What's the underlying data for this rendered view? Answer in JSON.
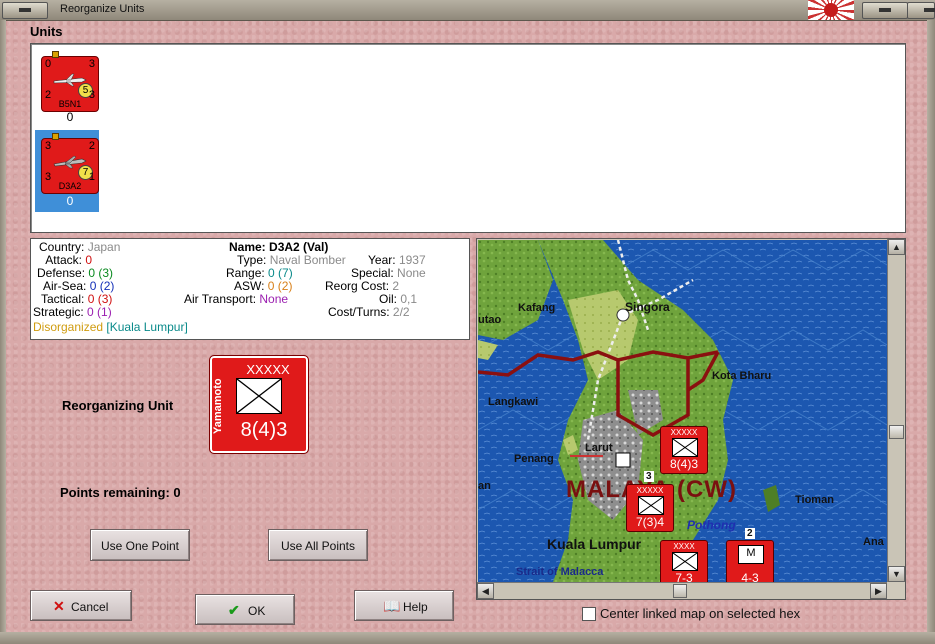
{
  "window": {
    "title": "Reorganize Units"
  },
  "units_section": {
    "label": "Units",
    "units": [
      {
        "name": "B5N1",
        "top_left": "0",
        "top_right": "3",
        "bottom_left": "2",
        "bottom_right": "3",
        "badge": "5",
        "count": "0"
      },
      {
        "name": "D3A2",
        "top_left": "3",
        "top_right": "2",
        "bottom_left": "3",
        "bottom_right": "1",
        "badge": "7",
        "count": "0",
        "selected": true
      }
    ]
  },
  "details": {
    "country_label": "Country:",
    "country": "Japan",
    "attack_label": "Attack:",
    "attack": "0",
    "defense_label": "Defense:",
    "defense": "0 (3)",
    "airsea_label": "Air-Sea:",
    "airsea": "0 (2)",
    "tactical_label": "Tactical:",
    "tactical": "0 (3)",
    "strategic_label": "Strategic:",
    "strategic": "0 (1)",
    "status": "Disorganized",
    "location": "[Kuala Lumpur]",
    "name_label": "Name:",
    "name": "D3A2 (Val)",
    "type_label": "Type:",
    "type": "Naval Bomber",
    "year_label": "Year:",
    "year": "1937",
    "range_label": "Range:",
    "range": "0 (7)",
    "special_label": "Special:",
    "special": "None",
    "asw_label": "ASW:",
    "asw": "0 (2)",
    "reorg_label": "Reorg Cost:",
    "reorg": "2",
    "airtransport_label": "Air Transport:",
    "airtransport": "None",
    "oil_label": "Oil:",
    "oil": "0,1",
    "costturns_label": "Cost/Turns:",
    "costturns": "2/2"
  },
  "reorganizing": {
    "label": "Reorganizing Unit",
    "commander": "Yamamoto",
    "size": "XXXXX",
    "strength": "8(4)3"
  },
  "points": {
    "label": "Points remaining:",
    "value": "0"
  },
  "buttons": {
    "use_one": "Use One Point",
    "use_all": "Use All Points",
    "cancel": "Cancel",
    "ok": "OK",
    "help": "Help"
  },
  "map": {
    "labels": {
      "singora": "Singora",
      "kafang": "Kafang",
      "utao": "utao",
      "langkawi": "Langkawi",
      "kota_bharu": "Kota Bharu",
      "larut": "Larut",
      "penang": "Penang",
      "malaya": "MALAYA (CW)",
      "tioman": "Tioman",
      "pothong": "Pothong",
      "kuala_lumpur": "Kuala Lumpur",
      "ana": "Ana",
      "an": "an",
      "strait": "Strait of Malacca"
    },
    "counters": [
      {
        "size": "XXXXX",
        "strength": "8(4)3"
      },
      {
        "size": "XXXXX",
        "strength": "7(3)4",
        "stack": "3"
      },
      {
        "size": "XXXX",
        "strength": "7-3"
      },
      {
        "size": "M",
        "strength": "4-3",
        "stack": "2"
      }
    ]
  },
  "center_linked": {
    "label": "Center linked map on selected hex",
    "checked": false
  },
  "colors": {
    "counter_red": "#e01a1a",
    "selected_blue": "#3f8fd8",
    "sea_blue": "#1c57b0",
    "land_green": "#6fa33c"
  }
}
